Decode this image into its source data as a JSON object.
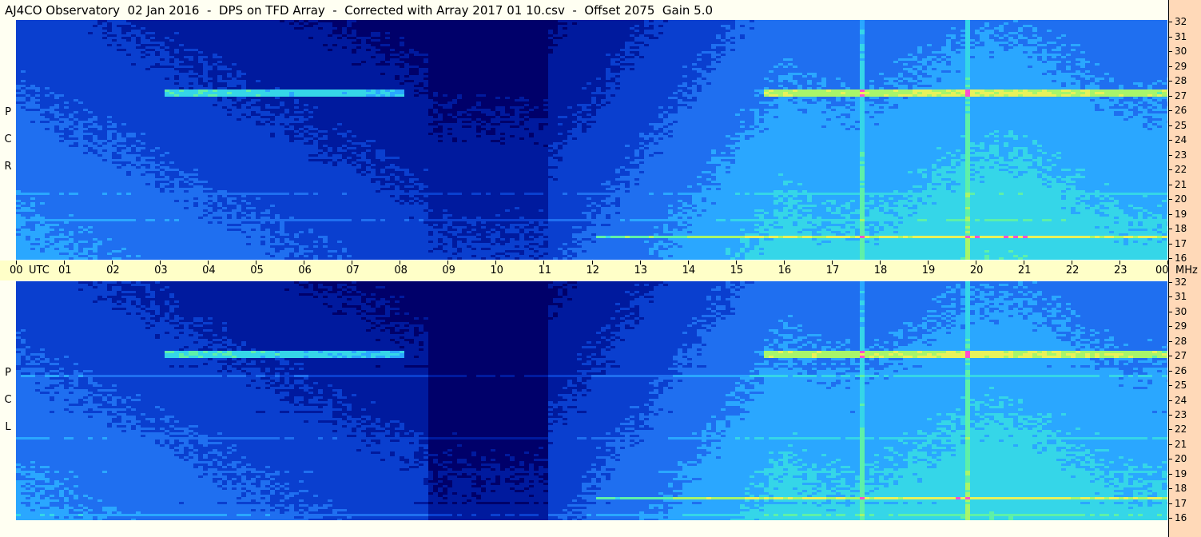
{
  "title": "AJ4CO Observatory  02 Jan 2016  -  DPS on TFD Array  -  Corrected with Array 2017 01 10.csv  -  Offset 2075  Gain 5.0",
  "chart_data": {
    "type": "heatmap",
    "title": "AJ4CO Observatory  02 Jan 2016  -  DPS on TFD Array  -  Corrected with Array 2017 01 10.csv  -  Offset 2075  Gain 5.0",
    "x_tick_labels": [
      "00",
      "01",
      "02",
      "03",
      "04",
      "05",
      "06",
      "07",
      "08",
      "09",
      "10",
      "11",
      "12",
      "13",
      "14",
      "15",
      "16",
      "17",
      "18",
      "19",
      "20",
      "21",
      "22",
      "23",
      "00"
    ],
    "x_unit": "UTC",
    "y_unit": "MHz",
    "y_tick_labels": [
      "32",
      "31",
      "30",
      "29",
      "28",
      "27",
      "26",
      "25",
      "24",
      "23",
      "22",
      "21",
      "20",
      "19",
      "18",
      "17",
      "16"
    ],
    "xlim": [
      0,
      24
    ],
    "ylim": [
      16,
      32
    ],
    "panels": [
      {
        "name": "RCP",
        "label_letters": [
          "R",
          "C",
          "P"
        ]
      },
      {
        "name": "LCP",
        "label_letters": [
          "L",
          "C",
          "P"
        ]
      }
    ],
    "colormap": [
      "#00006a",
      "#001a9e",
      "#0a3fcf",
      "#1f6ff0",
      "#2aa7ff",
      "#35d6e8",
      "#5ef0a8",
      "#a8f56a",
      "#e8f25a",
      "#ff4fd0",
      "#ffffff"
    ]
  }
}
